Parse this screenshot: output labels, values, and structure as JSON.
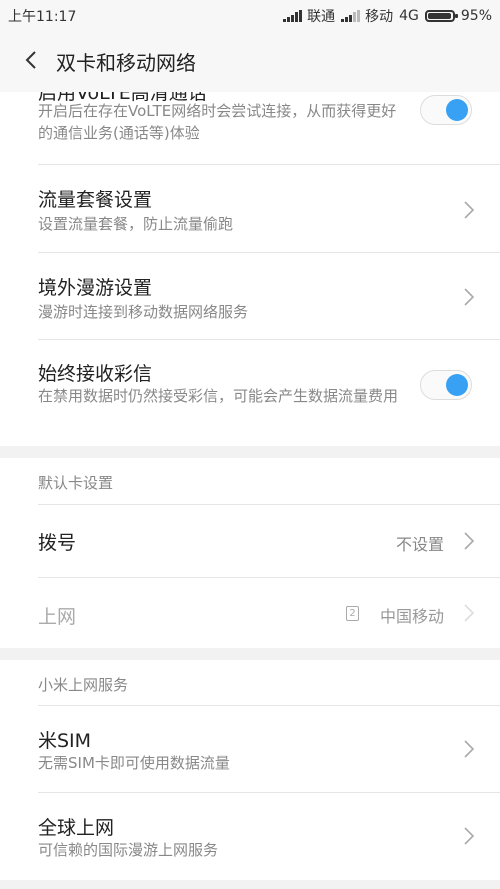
{
  "status_bar": {
    "time": "上午11:17",
    "carrier1": "联通",
    "carrier2": "移动",
    "network": "4G",
    "battery": "95%",
    "battery_level": 0.95
  },
  "header": {
    "title": "双卡和移动网络",
    "back_icon": "back-arrow-icon"
  },
  "volte": {
    "title": "启用VoLTE高清通话",
    "subtitle": "开启后在存在VoLTE网络时会尝试连接，从而获得更好的通信业务(通话等)体验",
    "enabled": true
  },
  "data_plan": {
    "title": "流量套餐设置",
    "subtitle": "设置流量套餐，防止流量偷跑"
  },
  "roaming": {
    "title": "境外漫游设置",
    "subtitle": "漫游时连接到移动数据网络服务"
  },
  "mms": {
    "title": "始终接收彩信",
    "subtitle": "在禁用数据时仍然接受彩信，可能会产生数据流量费用",
    "enabled": true
  },
  "default_card": {
    "section_label": "默认卡设置",
    "dial_label": "拨号",
    "dial_value": "不设置",
    "internet_label": "上网",
    "internet_sim": "2",
    "internet_value": "中国移动"
  },
  "mi_service": {
    "section_label": "小米上网服务",
    "mi_sim_title": "米SIM",
    "mi_sim_subtitle": "无需SIM卡即可使用数据流量",
    "global_title": "全球上网",
    "global_subtitle": "可信赖的国际漫游上网服务"
  },
  "colors": {
    "accent": "#38a1f3",
    "background": "#f2f2f2",
    "card": "#ffffff"
  }
}
